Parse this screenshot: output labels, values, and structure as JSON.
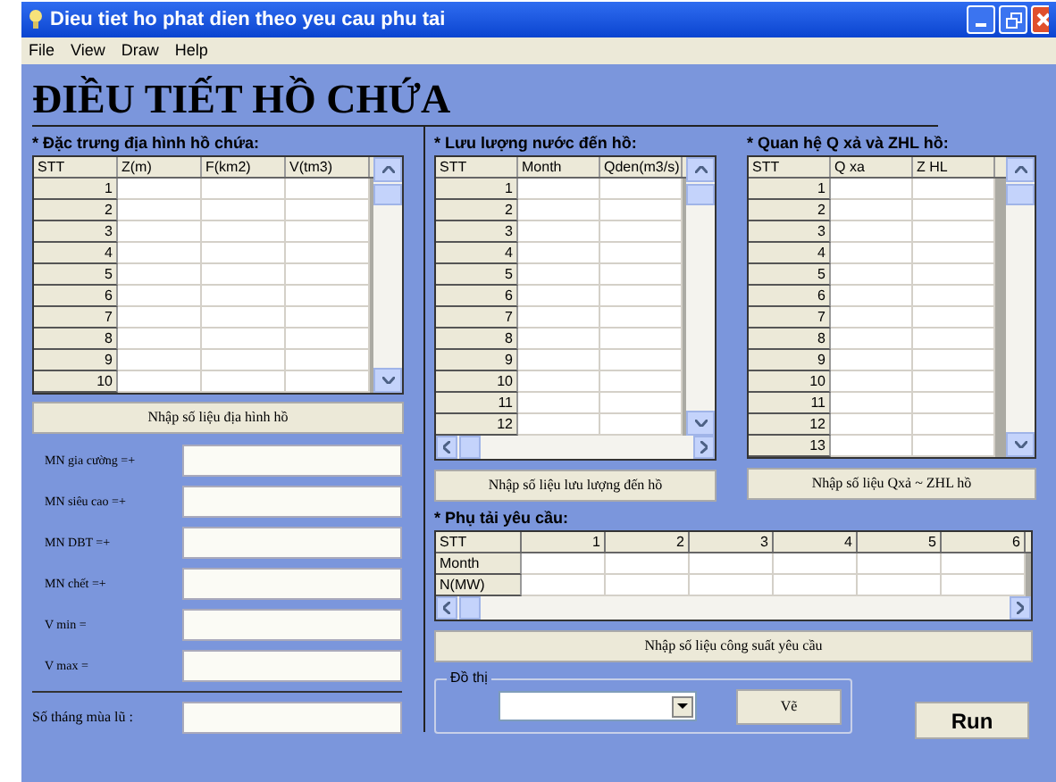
{
  "window": {
    "title": "Dieu tiet ho phat dien theo yeu cau phu tai"
  },
  "menu": [
    "File",
    "View",
    "Draw",
    "Help"
  ],
  "heading": "ĐIỀU TIẾT HỒ CHỨA",
  "terrain": {
    "label": "* Đặc trưng địa hình hồ chứa:",
    "columns": [
      "STT",
      "Z(m)",
      "F(km2)",
      "V(tm3)"
    ],
    "rows": [
      "1",
      "2",
      "3",
      "4",
      "5",
      "6",
      "7",
      "8",
      "9",
      "10"
    ],
    "button": "Nhập số liệu địa hình hồ"
  },
  "levels": [
    {
      "label": "MN gia cường =+"
    },
    {
      "label": "MN siêu cao =+"
    },
    {
      "label": "MN DBT =+"
    },
    {
      "label": "MN chết =+"
    },
    {
      "label": "V min ="
    },
    {
      "label": "V max ="
    }
  ],
  "flood_months": {
    "label": "Số tháng mùa lũ :"
  },
  "inflow": {
    "label": "* Lưu lượng nước đến hồ:",
    "columns": [
      "STT",
      "Month",
      "Qden(m3/s)"
    ],
    "rows": [
      "1",
      "2",
      "3",
      "4",
      "5",
      "6",
      "7",
      "8",
      "9",
      "10",
      "11",
      "12"
    ],
    "button": "Nhập số liệu lưu lượng đến hồ"
  },
  "discharge": {
    "label": "* Quan hệ Q xả và ZHL hồ:",
    "columns": [
      "STT",
      "Q xa",
      "Z HL"
    ],
    "rows": [
      "1",
      "2",
      "3",
      "4",
      "5",
      "6",
      "7",
      "8",
      "9",
      "10",
      "11",
      "12",
      "13"
    ],
    "button": "Nhập số liệu Qxả ~ ZHL hồ"
  },
  "load": {
    "label": "* Phụ tải yêu cầu:",
    "columns": [
      "STT",
      "1",
      "2",
      "3",
      "4",
      "5",
      "6"
    ],
    "rows": [
      "Month",
      "N(MW)"
    ],
    "button": "Nhập số liệu công suất yêu cầu"
  },
  "chart_group": {
    "label": "Đồ thị",
    "button": "Vẽ"
  },
  "run_button": "Run"
}
